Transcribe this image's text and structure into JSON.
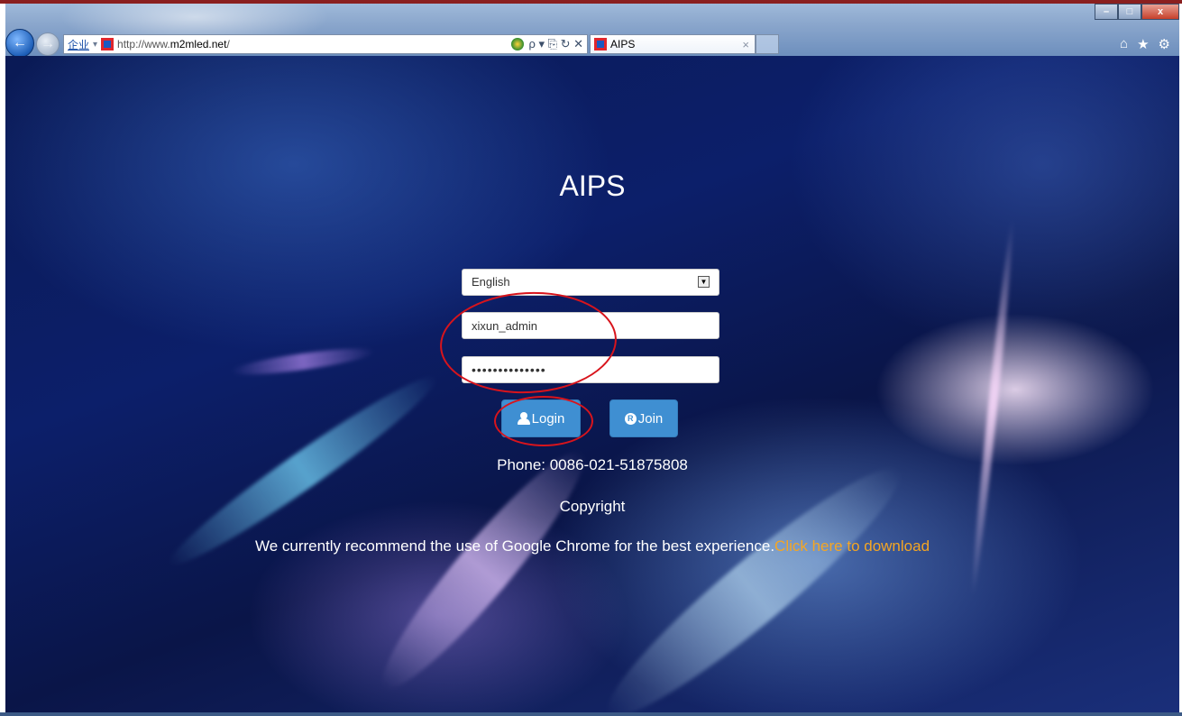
{
  "browser": {
    "address_prefix": "企业",
    "url_plain": "http://www.",
    "url_bold": "m2mled.net",
    "url_suffix": "/",
    "addr_tools": "ρ ▾ ⎘ ↻ ✕",
    "tab_title": "AIPS",
    "tab_close": "×",
    "win_min": "–",
    "win_max": "□",
    "win_close": "x",
    "home_icon": "home-icon",
    "star_icon": "star-icon",
    "gear_icon": "gear-icon"
  },
  "page": {
    "title": "AIPS",
    "language_selected": "English",
    "username_value": "xixun_admin",
    "password_mask": "••••••••••••••",
    "login_label": "Login",
    "join_label": "Join",
    "phone": "Phone: 0086-021-51875808",
    "copyright": "Copyright",
    "recommend_text": "We currently recommend the use of Google Chrome for the best experience.",
    "download_link": "Click here to download"
  }
}
